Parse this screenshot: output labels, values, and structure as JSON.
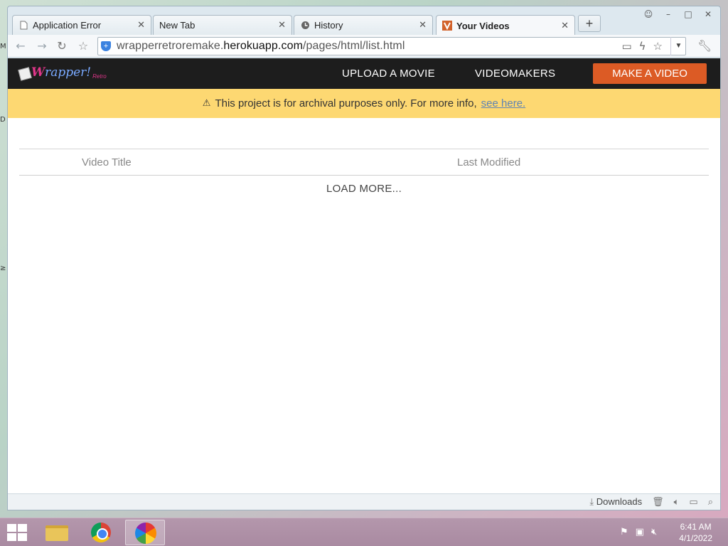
{
  "browser": {
    "tabs": [
      {
        "label": "Application Error",
        "icon": "document-icon",
        "active": false
      },
      {
        "label": "New Tab",
        "icon": "",
        "active": false
      },
      {
        "label": "History",
        "icon": "clock-icon",
        "active": false
      },
      {
        "label": "Your Videos",
        "icon": "v-favicon",
        "active": true
      }
    ],
    "url_prefix": "wrapperretroremake.",
    "url_host": "herokuapp.com",
    "url_path": "/pages/html/list.html"
  },
  "site": {
    "logo_w": "W",
    "logo_text": "rapper!",
    "logo_sub": "Retro",
    "nav": {
      "upload": "UPLOAD A MOVIE",
      "videomakers": "VIDEOMAKERS",
      "make": "MAKE A VIDEO"
    },
    "notice_text": "This project is for archival purposes only. For more info,",
    "notice_link": "see here.",
    "table": {
      "col_title": "Video Title",
      "col_modified": "Last Modified"
    },
    "load_more": "LOAD MORE..."
  },
  "statusbar": {
    "downloads": "Downloads"
  },
  "taskbar": {
    "time": "6:41 AM",
    "date": "4/1/2022"
  },
  "colors": {
    "nav_bg": "#1d1d1d",
    "cta": "#dc5b25",
    "notice_bg": "#fdd872",
    "link": "#5f84b4"
  }
}
